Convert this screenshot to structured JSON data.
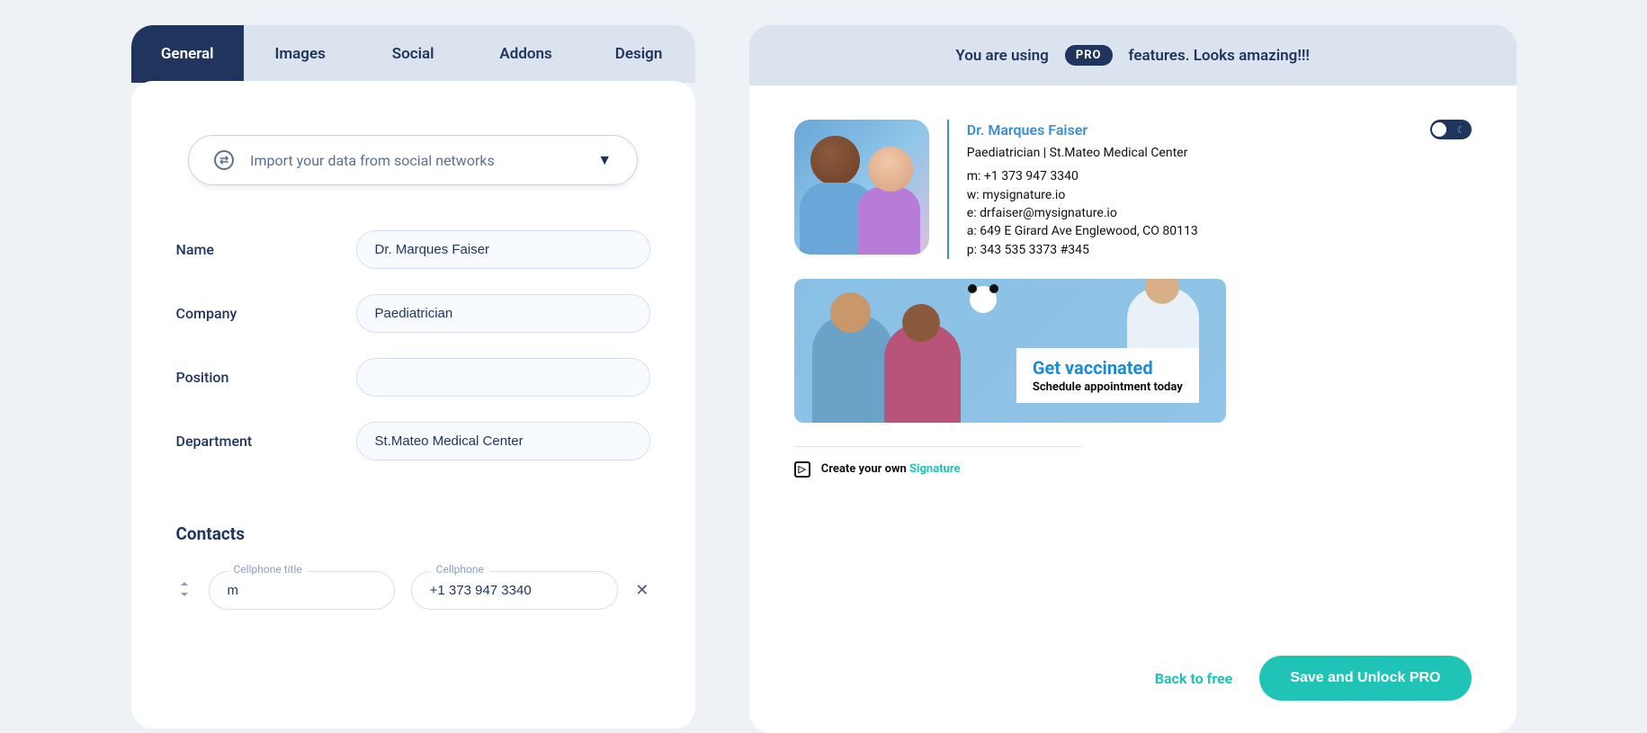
{
  "tabs": [
    "General",
    "Images",
    "Social",
    "Addons",
    "Design"
  ],
  "import_text": "Import your data from social networks",
  "fields": {
    "name_label": "Name",
    "name_value": "Dr. Marques Faiser",
    "company_label": "Company",
    "company_value": "Paediatrician",
    "position_label": "Position",
    "position_value": "",
    "department_label": "Department",
    "department_value": "St.Mateo Medical Center"
  },
  "contacts": {
    "section_title": "Contacts",
    "cell_title_label": "Cellphone title",
    "cell_title_value": "m",
    "cell_label": "Cellphone",
    "cell_value": "+1 373 947 3340"
  },
  "header": {
    "text_before": "You are using",
    "badge": "PRO",
    "text_after": "features. Looks amazing!!!"
  },
  "signature": {
    "name": "Dr. Marques Faiser",
    "subtitle": "Paediatrician | St.Mateo Medical Center",
    "mobile": "m: +1 373 947 3340",
    "website": "w: mysignature.io",
    "email": "e: drfaiser@mysignature.io",
    "address": "a: 649 E Girard Ave Englewood, CO 80113",
    "phone": "p: 343 535 3373 #345"
  },
  "banner": {
    "title": "Get vaccinated",
    "subtitle": "Schedule appointment today"
  },
  "create_own": {
    "prefix": "Create your own ",
    "link": "Signature"
  },
  "footer": {
    "back": "Back to free",
    "save": "Save and Unlock PRO"
  }
}
